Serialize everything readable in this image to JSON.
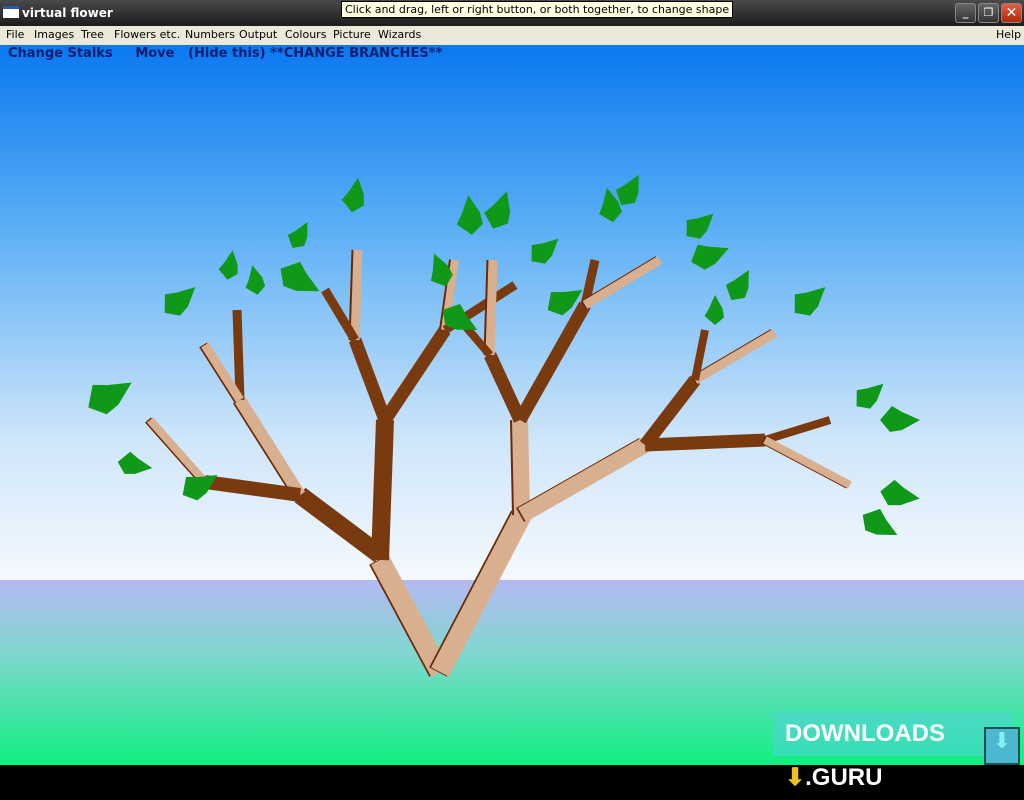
{
  "window": {
    "title": "virtual flower",
    "tooltip": "Click and drag, left or right button, or both together, to change shape"
  },
  "menu": [
    "File",
    "Images",
    "Tree",
    "Flowers etc.",
    "Numbers",
    "Output",
    "Colours",
    "Picture",
    "Wizards"
  ],
  "help": "Help",
  "commands": {
    "change_stalks": "Change Stalks",
    "move": "Move",
    "hide": "(Hide this)",
    "change_branches": "**CHANGE BRANCHES**"
  },
  "watermark": {
    "text1": "DOWNLOADS",
    "text2": ".GURU"
  },
  "colors": {
    "sky": "#0a78f0",
    "dark_branch": "#7a3a10",
    "light_branch": "#d8b090",
    "leaf": "#109818"
  }
}
